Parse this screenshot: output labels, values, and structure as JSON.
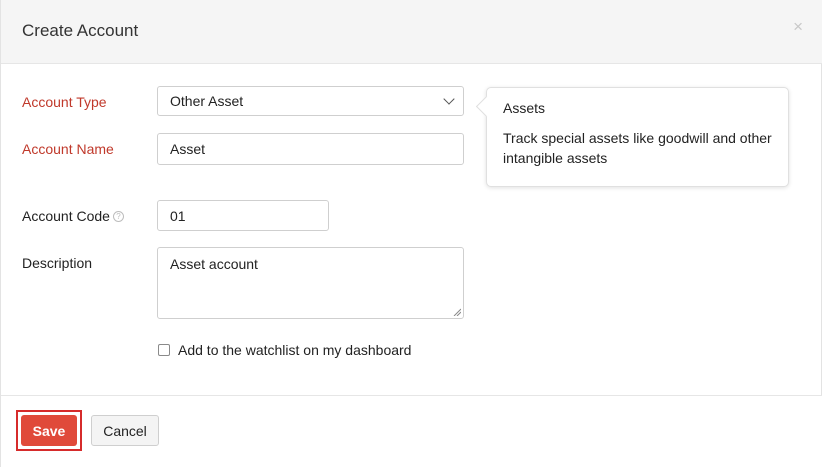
{
  "modal": {
    "title": "Create Account",
    "close_symbol": "×"
  },
  "form": {
    "account_type": {
      "label": "Account Type",
      "value": "Other Asset"
    },
    "account_name": {
      "label": "Account Name",
      "value": "Asset"
    },
    "account_code": {
      "label": "Account Code",
      "help_symbol": "?",
      "value": "01"
    },
    "description": {
      "label": "Description",
      "value": "Asset account"
    },
    "watchlist": {
      "label": "Add to the watchlist on my dashboard",
      "checked": false
    }
  },
  "tooltip": {
    "title": "Assets",
    "body": "Track special assets like goodwill and other intangible assets"
  },
  "footer": {
    "save_label": "Save",
    "cancel_label": "Cancel"
  },
  "colors": {
    "required_label": "#c0392b",
    "save_button": "#e04a3a",
    "save_outline": "#d62b2b"
  },
  "icons": {
    "close": "close-icon",
    "dropdown": "chevron-down-icon",
    "help": "help-icon",
    "resize": "resize-grip-icon"
  }
}
